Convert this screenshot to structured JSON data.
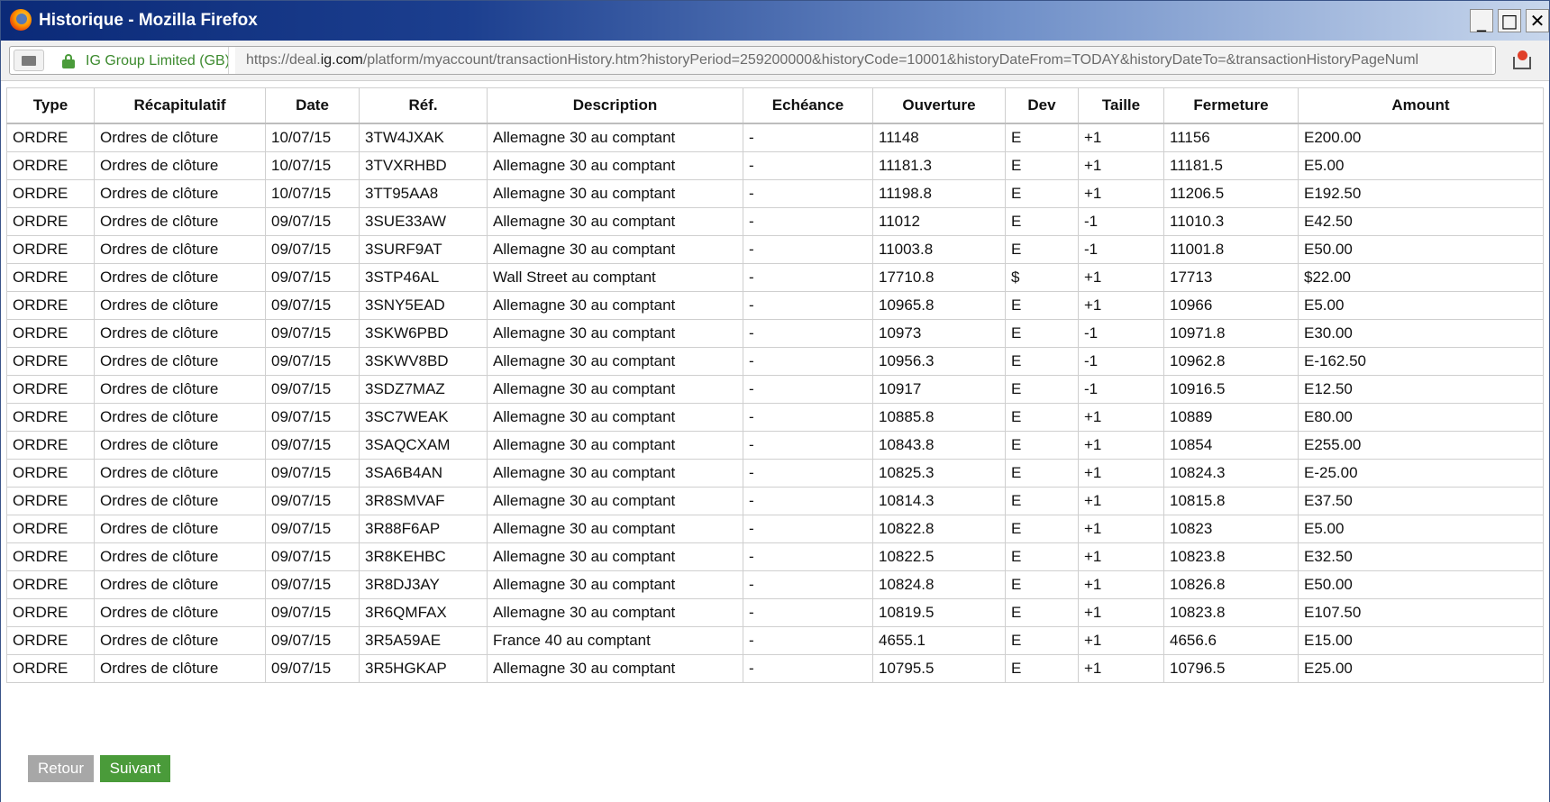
{
  "window": {
    "title": "Historique - Mozilla Firefox",
    "controls": {
      "minimize": "_",
      "maximize": "□",
      "close": "✕"
    }
  },
  "urlbar": {
    "identity": "IG Group Limited (GB)",
    "url_prefix": "https://deal.",
    "url_host": "ig.com",
    "url_rest": "/platform/myaccount/transactionHistory.htm?historyPeriod=259200000&historyCode=10001&historyDateFrom=TODAY&historyDateTo=&transactionHistoryPageNuml"
  },
  "table": {
    "headers": {
      "type": "Type",
      "recap": "Récapitulatif",
      "date": "Date",
      "ref": "Réf.",
      "description": "Description",
      "echeance": "Echéance",
      "ouverture": "Ouverture",
      "dev": "Dev",
      "taille": "Taille",
      "fermeture": "Fermeture",
      "amount": "Amount"
    },
    "rows": [
      {
        "type": "ORDRE",
        "recap": "Ordres de clôture",
        "date": "10/07/15",
        "ref": "3TW4JXAK",
        "description": "Allemagne 30 au comptant",
        "echeance": "-",
        "ouverture": "11148",
        "dev": "E",
        "taille": "+1",
        "fermeture": "11156",
        "amount": "E200.00"
      },
      {
        "type": "ORDRE",
        "recap": "Ordres de clôture",
        "date": "10/07/15",
        "ref": "3TVXRHBD",
        "description": "Allemagne 30 au comptant",
        "echeance": "-",
        "ouverture": "11181.3",
        "dev": "E",
        "taille": "+1",
        "fermeture": "11181.5",
        "amount": "E5.00"
      },
      {
        "type": "ORDRE",
        "recap": "Ordres de clôture",
        "date": "10/07/15",
        "ref": "3TT95AA8",
        "description": "Allemagne 30 au comptant",
        "echeance": "-",
        "ouverture": "11198.8",
        "dev": "E",
        "taille": "+1",
        "fermeture": "11206.5",
        "amount": "E192.50"
      },
      {
        "type": "ORDRE",
        "recap": "Ordres de clôture",
        "date": "09/07/15",
        "ref": "3SUE33AW",
        "description": "Allemagne 30 au comptant",
        "echeance": "-",
        "ouverture": "11012",
        "dev": "E",
        "taille": "-1",
        "fermeture": "11010.3",
        "amount": "E42.50"
      },
      {
        "type": "ORDRE",
        "recap": "Ordres de clôture",
        "date": "09/07/15",
        "ref": "3SURF9AT",
        "description": "Allemagne 30 au comptant",
        "echeance": "-",
        "ouverture": "11003.8",
        "dev": "E",
        "taille": "-1",
        "fermeture": "11001.8",
        "amount": "E50.00"
      },
      {
        "type": "ORDRE",
        "recap": "Ordres de clôture",
        "date": "09/07/15",
        "ref": "3STP46AL",
        "description": "Wall Street au comptant",
        "echeance": "-",
        "ouverture": "17710.8",
        "dev": "$",
        "taille": "+1",
        "fermeture": "17713",
        "amount": "$22.00"
      },
      {
        "type": "ORDRE",
        "recap": "Ordres de clôture",
        "date": "09/07/15",
        "ref": "3SNY5EAD",
        "description": "Allemagne 30 au comptant",
        "echeance": "-",
        "ouverture": "10965.8",
        "dev": "E",
        "taille": "+1",
        "fermeture": "10966",
        "amount": "E5.00"
      },
      {
        "type": "ORDRE",
        "recap": "Ordres de clôture",
        "date": "09/07/15",
        "ref": "3SKW6PBD",
        "description": "Allemagne 30 au comptant",
        "echeance": "-",
        "ouverture": "10973",
        "dev": "E",
        "taille": "-1",
        "fermeture": "10971.8",
        "amount": "E30.00"
      },
      {
        "type": "ORDRE",
        "recap": "Ordres de clôture",
        "date": "09/07/15",
        "ref": "3SKWV8BD",
        "description": "Allemagne 30 au comptant",
        "echeance": "-",
        "ouverture": "10956.3",
        "dev": "E",
        "taille": "-1",
        "fermeture": "10962.8",
        "amount": "E-162.50"
      },
      {
        "type": "ORDRE",
        "recap": "Ordres de clôture",
        "date": "09/07/15",
        "ref": "3SDZ7MAZ",
        "description": "Allemagne 30 au comptant",
        "echeance": "-",
        "ouverture": "10917",
        "dev": "E",
        "taille": "-1",
        "fermeture": "10916.5",
        "amount": "E12.50"
      },
      {
        "type": "ORDRE",
        "recap": "Ordres de clôture",
        "date": "09/07/15",
        "ref": "3SC7WEAK",
        "description": "Allemagne 30 au comptant",
        "echeance": "-",
        "ouverture": "10885.8",
        "dev": "E",
        "taille": "+1",
        "fermeture": "10889",
        "amount": "E80.00"
      },
      {
        "type": "ORDRE",
        "recap": "Ordres de clôture",
        "date": "09/07/15",
        "ref": "3SAQCXAM",
        "description": "Allemagne 30 au comptant",
        "echeance": "-",
        "ouverture": "10843.8",
        "dev": "E",
        "taille": "+1",
        "fermeture": "10854",
        "amount": "E255.00"
      },
      {
        "type": "ORDRE",
        "recap": "Ordres de clôture",
        "date": "09/07/15",
        "ref": "3SA6B4AN",
        "description": "Allemagne 30 au comptant",
        "echeance": "-",
        "ouverture": "10825.3",
        "dev": "E",
        "taille": "+1",
        "fermeture": "10824.3",
        "amount": "E-25.00"
      },
      {
        "type": "ORDRE",
        "recap": "Ordres de clôture",
        "date": "09/07/15",
        "ref": "3R8SMVAF",
        "description": "Allemagne 30 au comptant",
        "echeance": "-",
        "ouverture": "10814.3",
        "dev": "E",
        "taille": "+1",
        "fermeture": "10815.8",
        "amount": "E37.50"
      },
      {
        "type": "ORDRE",
        "recap": "Ordres de clôture",
        "date": "09/07/15",
        "ref": "3R88F6AP",
        "description": "Allemagne 30 au comptant",
        "echeance": "-",
        "ouverture": "10822.8",
        "dev": "E",
        "taille": "+1",
        "fermeture": "10823",
        "amount": "E5.00"
      },
      {
        "type": "ORDRE",
        "recap": "Ordres de clôture",
        "date": "09/07/15",
        "ref": "3R8KEHBC",
        "description": "Allemagne 30 au comptant",
        "echeance": "-",
        "ouverture": "10822.5",
        "dev": "E",
        "taille": "+1",
        "fermeture": "10823.8",
        "amount": "E32.50"
      },
      {
        "type": "ORDRE",
        "recap": "Ordres de clôture",
        "date": "09/07/15",
        "ref": "3R8DJ3AY",
        "description": "Allemagne 30 au comptant",
        "echeance": "-",
        "ouverture": "10824.8",
        "dev": "E",
        "taille": "+1",
        "fermeture": "10826.8",
        "amount": "E50.00"
      },
      {
        "type": "ORDRE",
        "recap": "Ordres de clôture",
        "date": "09/07/15",
        "ref": "3R6QMFAX",
        "description": "Allemagne 30 au comptant",
        "echeance": "-",
        "ouverture": "10819.5",
        "dev": "E",
        "taille": "+1",
        "fermeture": "10823.8",
        "amount": "E107.50"
      },
      {
        "type": "ORDRE",
        "recap": "Ordres de clôture",
        "date": "09/07/15",
        "ref": "3R5A59AE",
        "description": "France 40 au comptant",
        "echeance": "-",
        "ouverture": "4655.1",
        "dev": "E",
        "taille": "+1",
        "fermeture": "4656.6",
        "amount": "E15.00"
      },
      {
        "type": "ORDRE",
        "recap": "Ordres de clôture",
        "date": "09/07/15",
        "ref": "3R5HGKAP",
        "description": "Allemagne 30 au comptant",
        "echeance": "-",
        "ouverture": "10795.5",
        "dev": "E",
        "taille": "+1",
        "fermeture": "10796.5",
        "amount": "E25.00"
      }
    ]
  },
  "nav": {
    "back_label": "Retour",
    "next_label": "Suivant"
  },
  "colors": {
    "titlebar_start": "#0b2a78",
    "identity_green": "#3c8a2e",
    "next_button": "#4a9b3a",
    "back_button": "#a7a7a7"
  }
}
